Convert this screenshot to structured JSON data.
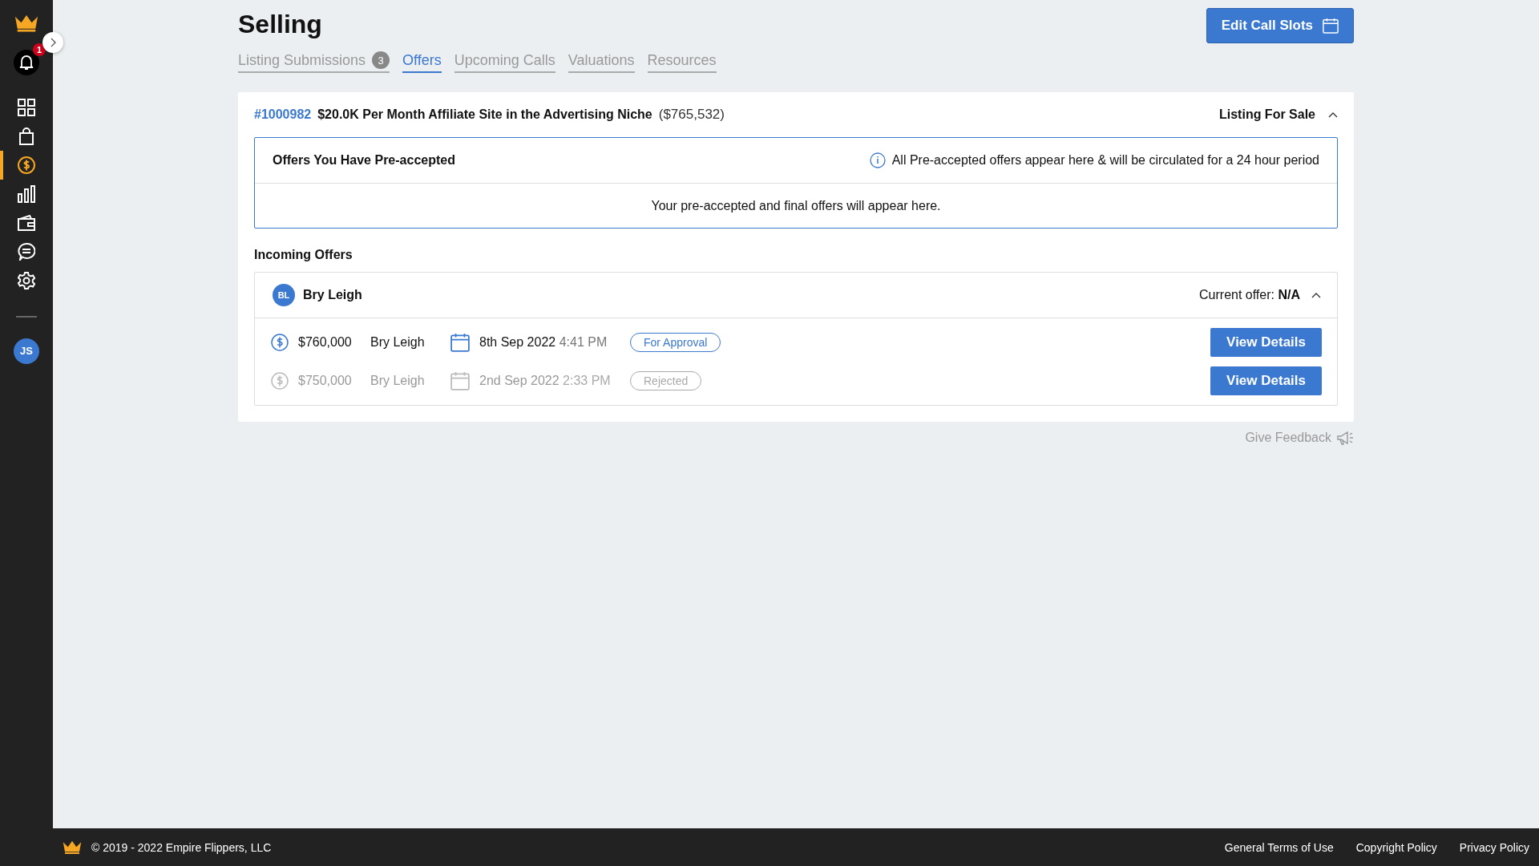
{
  "sidebar": {
    "notification_count": "1",
    "items": [
      {
        "kind": "dashboard",
        "selected": false
      },
      {
        "kind": "bag",
        "selected": false
      },
      {
        "kind": "dollar",
        "selected": true
      },
      {
        "kind": "chart",
        "selected": false
      },
      {
        "kind": "wallet",
        "selected": false
      },
      {
        "kind": "chat",
        "selected": false
      },
      {
        "kind": "settings",
        "selected": false
      }
    ],
    "avatar": "JS"
  },
  "page": {
    "title": "Selling",
    "action_button": "Edit Call Slots"
  },
  "tabs": [
    {
      "label": "Listing Submissions",
      "count": "3",
      "selected": false
    },
    {
      "label": "Offers",
      "selected": true
    },
    {
      "label": "Upcoming Calls",
      "selected": false
    },
    {
      "label": "Valuations",
      "selected": false
    },
    {
      "label": "Resources",
      "selected": false
    }
  ],
  "listing": {
    "id": "#1000982",
    "title": "$20.0K Per Month Affiliate Site in the Advertising Niche",
    "price": "($765,532)",
    "status": "Listing For Sale",
    "expanded": true,
    "preaccepted": {
      "title": "Offers You Have Pre-accepted",
      "info": "All Pre-accepted offers appear here & will be circulated for a 24 hour period",
      "empty_message": "Your pre-accepted and final offers will appear here."
    },
    "incoming": {
      "title": "Incoming Offers",
      "buyer": {
        "initials": "BL",
        "name": "Bry Leigh",
        "current_offer_label": "Current offer:",
        "current_offer": "N/A",
        "expanded": true
      },
      "offers": [
        {
          "amount": "$760,000",
          "buyer": "Bry Leigh",
          "date": "8th Sep 2022",
          "time": "4:41 PM",
          "status": "For Approval",
          "kind": "pending",
          "button": "View Details"
        },
        {
          "amount": "$750,000",
          "buyer": "Bry Leigh",
          "date": "2nd Sep 2022",
          "time": "2:33 PM",
          "status": "Rejected",
          "kind": "rejected",
          "button": "View Details"
        }
      ]
    }
  },
  "feedback": "Give Feedback",
  "footer": {
    "copyright": "© 2019 - 2022 Empire Flippers, LLC",
    "links": [
      "General Terms of Use",
      "Copyright Policy",
      "Privacy Policy"
    ]
  }
}
